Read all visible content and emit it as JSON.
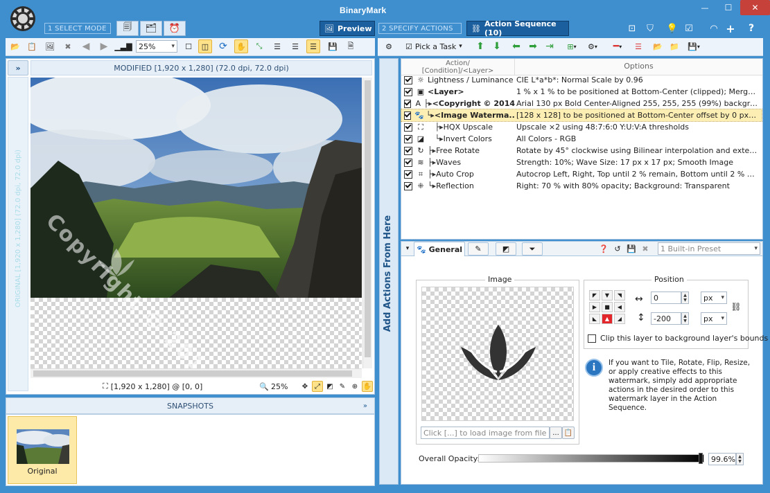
{
  "app": {
    "title": "BinaryMark"
  },
  "window_controls": {
    "minimize": "—",
    "maximize": "☐",
    "close": "✕"
  },
  "modes": {
    "select_mode": "1 SELECT MODE",
    "preview": "Preview",
    "specify_actions": "2 SPECIFY ACTIONS",
    "action_sequence": "Action Sequence (10)"
  },
  "toolbar_left": {
    "zoom": "25%"
  },
  "toolbar_right": {
    "pick_task": "Pick a Task"
  },
  "preview": {
    "header": "MODIFIED [1,920 x 1,280] (72.0 dpi, 72.0 dpi)",
    "side_label": "ORIGINAL [1,920 x 1,280] (72.0 dpi, 72.0 dpi)",
    "status_coords": "[1,920 x 1,280] @ [0, 0]",
    "status_zoom": "25%",
    "watermark_text": "Copyright © 2014"
  },
  "snapshots": {
    "title": "SNAPSHOTS",
    "items": [
      {
        "label": "Original"
      }
    ]
  },
  "side_tab": {
    "label": "Add Actions From Here"
  },
  "actions": {
    "columns": {
      "action": "Action/",
      "action_sub": "[Condition]/<Layer>",
      "options": "Options"
    },
    "rows": [
      {
        "indent": "",
        "icon": "sun-icon",
        "glyph": "☼",
        "name": "Lightness / Luminance",
        "options": "CIE L*a*b*: Normal Scale by 0.96",
        "bold": false,
        "selected": false
      },
      {
        "indent": "",
        "icon": "layer-icon",
        "glyph": "▣",
        "name": "<Layer>",
        "options": "1 % x 1 % to be positioned at Bottom-Center (clipped); Merge R,...",
        "bold": true,
        "selected": false
      },
      {
        "indent": "├▸",
        "icon": "text-icon",
        "glyph": "A",
        "name": "<Copyright © 2014",
        "options": "Arial 130 px Bold Center-Aligned 255, 255, 255 (99%) backgroun...",
        "bold": true,
        "selected": false
      },
      {
        "indent": "└▸",
        "icon": "paw-icon",
        "glyph": "🐾",
        "name": "<Image Waterma...",
        "options": "[128 x 128] to be positioned at Bottom-Center offset by 0 px, -20...",
        "bold": true,
        "selected": true
      },
      {
        "indent": "   ├▸",
        "icon": "upscale-icon",
        "glyph": "⛶",
        "name": "HQX Upscale",
        "options": "Upscale ×2 using 48:7:6:0 Y:U:V:A thresholds",
        "bold": false,
        "selected": false
      },
      {
        "indent": "   └▸",
        "icon": "invert-icon",
        "glyph": "◪",
        "name": "Invert Colors",
        "options": "All Colors - RGB",
        "bold": false,
        "selected": false
      },
      {
        "indent": "├▸",
        "icon": "rotate-icon",
        "glyph": "↻",
        "name": "Free Rotate",
        "options": "Rotate by 45° clockwise using Bilinear interpolation and extend fill...",
        "bold": false,
        "selected": false
      },
      {
        "indent": "├▸",
        "icon": "waves-icon",
        "glyph": "≋",
        "name": "Waves",
        "options": "Strength: 10%; Wave Size: 17 px x 17 px; Smooth Image",
        "bold": false,
        "selected": false
      },
      {
        "indent": "├▸",
        "icon": "crop-icon",
        "glyph": "⌗",
        "name": "Auto Crop",
        "options": "Autocrop Left, Right, Top until 2 % remain, Bottom until 2 % remai...",
        "bold": false,
        "selected": false
      },
      {
        "indent": "└▸",
        "icon": "reflection-icon",
        "glyph": "⁜",
        "name": "Reflection",
        "options": "Right: 70 % with 80% opacity; Background: Transparent",
        "bold": false,
        "selected": false
      }
    ]
  },
  "settings": {
    "tab_general": "General",
    "preset": "1 Built-in Preset",
    "image_group": "Image",
    "image_field_placeholder": "Click [...] to load image from file",
    "browse_label": "...",
    "position_group": "Position",
    "x_value": "0",
    "y_value": "-200",
    "x_unit": "px",
    "y_unit": "px",
    "clip_label": "Clip this layer to background layer's bounds",
    "info_text": "If you want to Tile, Rotate, Flip, Resize, or apply creative effects to this watermark, simply add appropriate actions in the desired order to this watermark layer in the Action Sequence.",
    "opacity_label": "Overall Opacity:",
    "opacity_value": "99.6%",
    "opacity_fraction": 0.996
  },
  "colors": {
    "frame": "#3f8fcf",
    "active_tab": "#1b5f9e",
    "selected_row": "#fdeeb3",
    "highlight": "#fde28a"
  }
}
